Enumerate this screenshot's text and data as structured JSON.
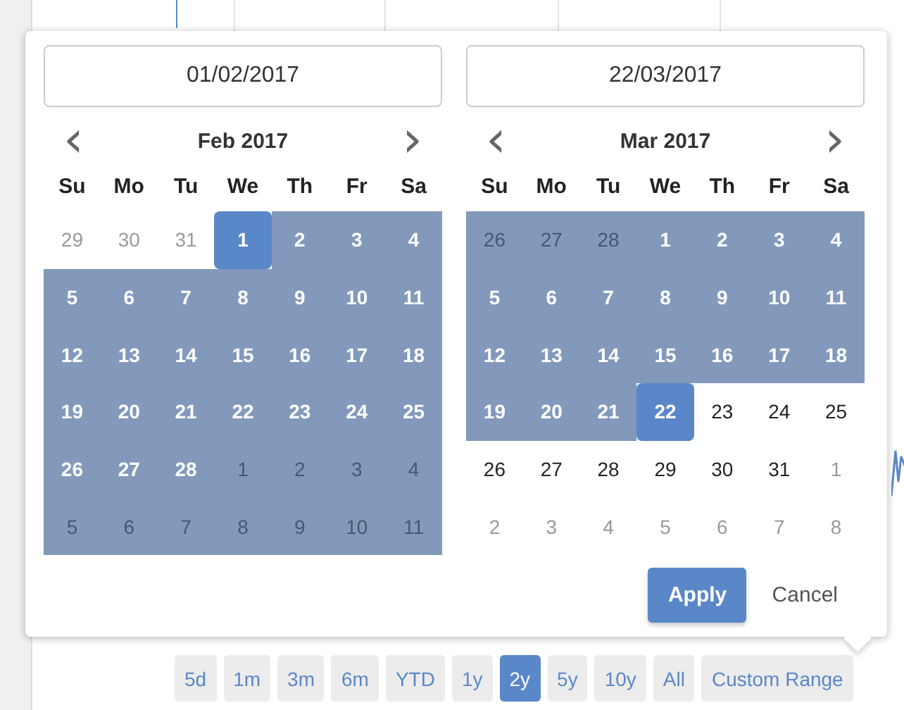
{
  "picker": {
    "calendars": [
      {
        "start_date": "01/02/2017",
        "title": "Feb 2017",
        "prev": "‹",
        "next": "›",
        "weekdays": [
          "Su",
          "Mo",
          "Tu",
          "We",
          "Th",
          "Fr",
          "Sa"
        ],
        "weeks": [
          [
            {
              "label": "29",
              "muted": true,
              "in_range": false,
              "selected": false
            },
            {
              "label": "30",
              "muted": true,
              "in_range": false,
              "selected": false
            },
            {
              "label": "31",
              "muted": true,
              "in_range": false,
              "selected": false
            },
            {
              "label": "1",
              "muted": false,
              "in_range": true,
              "selected": true
            },
            {
              "label": "2",
              "muted": false,
              "in_range": true,
              "selected": false
            },
            {
              "label": "3",
              "muted": false,
              "in_range": true,
              "selected": false
            },
            {
              "label": "4",
              "muted": false,
              "in_range": true,
              "selected": false
            }
          ],
          [
            {
              "label": "5",
              "muted": false,
              "in_range": true,
              "selected": false
            },
            {
              "label": "6",
              "muted": false,
              "in_range": true,
              "selected": false
            },
            {
              "label": "7",
              "muted": false,
              "in_range": true,
              "selected": false
            },
            {
              "label": "8",
              "muted": false,
              "in_range": true,
              "selected": false
            },
            {
              "label": "9",
              "muted": false,
              "in_range": true,
              "selected": false
            },
            {
              "label": "10",
              "muted": false,
              "in_range": true,
              "selected": false
            },
            {
              "label": "11",
              "muted": false,
              "in_range": true,
              "selected": false
            }
          ],
          [
            {
              "label": "12",
              "muted": false,
              "in_range": true,
              "selected": false
            },
            {
              "label": "13",
              "muted": false,
              "in_range": true,
              "selected": false
            },
            {
              "label": "14",
              "muted": false,
              "in_range": true,
              "selected": false
            },
            {
              "label": "15",
              "muted": false,
              "in_range": true,
              "selected": false
            },
            {
              "label": "16",
              "muted": false,
              "in_range": true,
              "selected": false
            },
            {
              "label": "17",
              "muted": false,
              "in_range": true,
              "selected": false
            },
            {
              "label": "18",
              "muted": false,
              "in_range": true,
              "selected": false
            }
          ],
          [
            {
              "label": "19",
              "muted": false,
              "in_range": true,
              "selected": false
            },
            {
              "label": "20",
              "muted": false,
              "in_range": true,
              "selected": false
            },
            {
              "label": "21",
              "muted": false,
              "in_range": true,
              "selected": false
            },
            {
              "label": "22",
              "muted": false,
              "in_range": true,
              "selected": false
            },
            {
              "label": "23",
              "muted": false,
              "in_range": true,
              "selected": false
            },
            {
              "label": "24",
              "muted": false,
              "in_range": true,
              "selected": false
            },
            {
              "label": "25",
              "muted": false,
              "in_range": true,
              "selected": false
            }
          ],
          [
            {
              "label": "26",
              "muted": false,
              "in_range": true,
              "selected": false
            },
            {
              "label": "27",
              "muted": false,
              "in_range": true,
              "selected": false
            },
            {
              "label": "28",
              "muted": false,
              "in_range": true,
              "selected": false
            },
            {
              "label": "1",
              "muted": true,
              "in_range": true,
              "selected": false
            },
            {
              "label": "2",
              "muted": true,
              "in_range": true,
              "selected": false
            },
            {
              "label": "3",
              "muted": true,
              "in_range": true,
              "selected": false
            },
            {
              "label": "4",
              "muted": true,
              "in_range": true,
              "selected": false
            }
          ],
          [
            {
              "label": "5",
              "muted": true,
              "in_range": true,
              "selected": false
            },
            {
              "label": "6",
              "muted": true,
              "in_range": true,
              "selected": false
            },
            {
              "label": "7",
              "muted": true,
              "in_range": true,
              "selected": false
            },
            {
              "label": "8",
              "muted": true,
              "in_range": true,
              "selected": false
            },
            {
              "label": "9",
              "muted": true,
              "in_range": true,
              "selected": false
            },
            {
              "label": "10",
              "muted": true,
              "in_range": true,
              "selected": false
            },
            {
              "label": "11",
              "muted": true,
              "in_range": true,
              "selected": false
            }
          ]
        ]
      },
      {
        "start_date": "22/03/2017",
        "title": "Mar 2017",
        "prev": "‹",
        "next": "›",
        "weekdays": [
          "Su",
          "Mo",
          "Tu",
          "We",
          "Th",
          "Fr",
          "Sa"
        ],
        "weeks": [
          [
            {
              "label": "26",
              "muted": true,
              "in_range": true,
              "selected": false
            },
            {
              "label": "27",
              "muted": true,
              "in_range": true,
              "selected": false
            },
            {
              "label": "28",
              "muted": true,
              "in_range": true,
              "selected": false
            },
            {
              "label": "1",
              "muted": false,
              "in_range": true,
              "selected": false
            },
            {
              "label": "2",
              "muted": false,
              "in_range": true,
              "selected": false
            },
            {
              "label": "3",
              "muted": false,
              "in_range": true,
              "selected": false
            },
            {
              "label": "4",
              "muted": false,
              "in_range": true,
              "selected": false
            }
          ],
          [
            {
              "label": "5",
              "muted": false,
              "in_range": true,
              "selected": false
            },
            {
              "label": "6",
              "muted": false,
              "in_range": true,
              "selected": false
            },
            {
              "label": "7",
              "muted": false,
              "in_range": true,
              "selected": false
            },
            {
              "label": "8",
              "muted": false,
              "in_range": true,
              "selected": false
            },
            {
              "label": "9",
              "muted": false,
              "in_range": true,
              "selected": false
            },
            {
              "label": "10",
              "muted": false,
              "in_range": true,
              "selected": false
            },
            {
              "label": "11",
              "muted": false,
              "in_range": true,
              "selected": false
            }
          ],
          [
            {
              "label": "12",
              "muted": false,
              "in_range": true,
              "selected": false
            },
            {
              "label": "13",
              "muted": false,
              "in_range": true,
              "selected": false
            },
            {
              "label": "14",
              "muted": false,
              "in_range": true,
              "selected": false
            },
            {
              "label": "15",
              "muted": false,
              "in_range": true,
              "selected": false
            },
            {
              "label": "16",
              "muted": false,
              "in_range": true,
              "selected": false
            },
            {
              "label": "17",
              "muted": false,
              "in_range": true,
              "selected": false
            },
            {
              "label": "18",
              "muted": false,
              "in_range": true,
              "selected": false
            }
          ],
          [
            {
              "label": "19",
              "muted": false,
              "in_range": true,
              "selected": false
            },
            {
              "label": "20",
              "muted": false,
              "in_range": true,
              "selected": false
            },
            {
              "label": "21",
              "muted": false,
              "in_range": true,
              "selected": false
            },
            {
              "label": "22",
              "muted": false,
              "in_range": true,
              "selected": true
            },
            {
              "label": "23",
              "muted": false,
              "in_range": false,
              "selected": false
            },
            {
              "label": "24",
              "muted": false,
              "in_range": false,
              "selected": false
            },
            {
              "label": "25",
              "muted": false,
              "in_range": false,
              "selected": false
            }
          ],
          [
            {
              "label": "26",
              "muted": false,
              "in_range": false,
              "selected": false
            },
            {
              "label": "27",
              "muted": false,
              "in_range": false,
              "selected": false
            },
            {
              "label": "28",
              "muted": false,
              "in_range": false,
              "selected": false
            },
            {
              "label": "29",
              "muted": false,
              "in_range": false,
              "selected": false
            },
            {
              "label": "30",
              "muted": false,
              "in_range": false,
              "selected": false
            },
            {
              "label": "31",
              "muted": false,
              "in_range": false,
              "selected": false
            },
            {
              "label": "1",
              "muted": true,
              "in_range": false,
              "selected": false
            }
          ],
          [
            {
              "label": "2",
              "muted": true,
              "in_range": false,
              "selected": false
            },
            {
              "label": "3",
              "muted": true,
              "in_range": false,
              "selected": false
            },
            {
              "label": "4",
              "muted": true,
              "in_range": false,
              "selected": false
            },
            {
              "label": "5",
              "muted": true,
              "in_range": false,
              "selected": false
            },
            {
              "label": "6",
              "muted": true,
              "in_range": false,
              "selected": false
            },
            {
              "label": "7",
              "muted": true,
              "in_range": false,
              "selected": false
            },
            {
              "label": "8",
              "muted": true,
              "in_range": false,
              "selected": false
            }
          ]
        ]
      }
    ],
    "apply": "Apply",
    "cancel": "Cancel"
  },
  "range_buttons": [
    {
      "label": "5d",
      "selected": false
    },
    {
      "label": "1m",
      "selected": false
    },
    {
      "label": "3m",
      "selected": false
    },
    {
      "label": "6m",
      "selected": false
    },
    {
      "label": "YTD",
      "selected": false
    },
    {
      "label": "1y",
      "selected": false
    },
    {
      "label": "2y",
      "selected": true
    },
    {
      "label": "5y",
      "selected": false
    },
    {
      "label": "10y",
      "selected": false
    },
    {
      "label": "All",
      "selected": false
    },
    {
      "label": "Custom Range",
      "selected": false
    }
  ]
}
